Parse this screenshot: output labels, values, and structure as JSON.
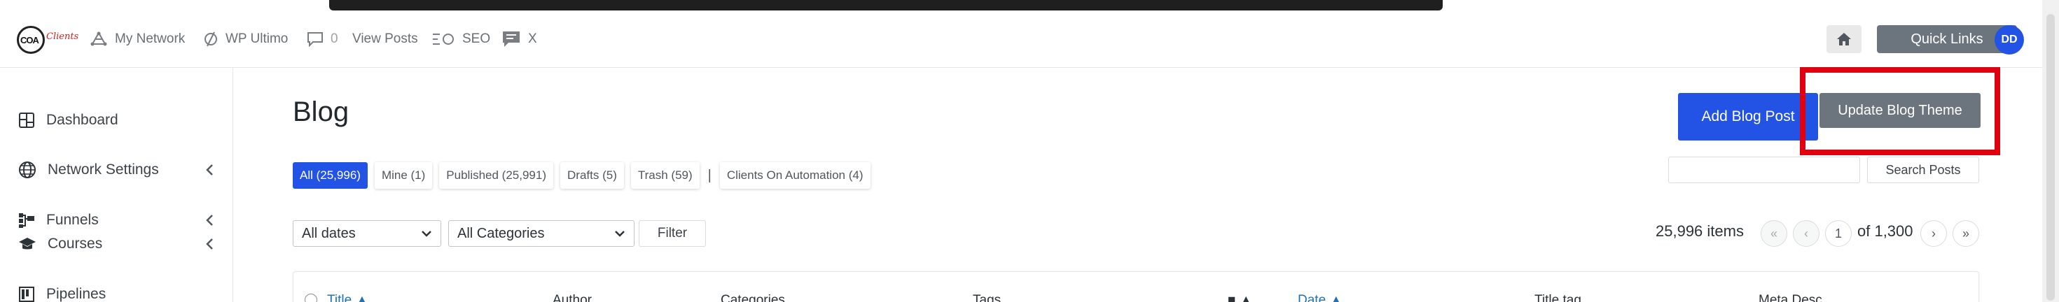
{
  "adminbar": {
    "logo_text": "COA",
    "logo_script": "Clients",
    "items": [
      {
        "label": "My Network",
        "icon": "network-icon"
      },
      {
        "label": "WP Ultimo",
        "icon": "wp-ultimo-icon"
      },
      {
        "label": "0",
        "icon": "comment-icon"
      },
      {
        "label": "View Posts",
        "icon": ""
      },
      {
        "label": "SEO",
        "icon": "seo-icon"
      },
      {
        "label": "X",
        "icon": "chat-icon"
      }
    ],
    "home_icon": "home-icon",
    "quick_links_label": "Quick Links",
    "avatar_initials": "DD"
  },
  "sidebar": {
    "items": [
      {
        "label": "Dashboard",
        "icon": "dashboard-icon",
        "has_chevron": false
      },
      {
        "label": "Network Settings",
        "icon": "globe-icon",
        "has_chevron": true
      },
      {
        "label": "Funnels",
        "icon": "funnel-icon",
        "has_chevron": true
      },
      {
        "label": "Courses",
        "icon": "graduation-cap-icon",
        "has_chevron": true
      },
      {
        "label": "Pipelines",
        "icon": "pipeline-icon",
        "has_chevron": false
      }
    ]
  },
  "main": {
    "title": "Blog",
    "add_button": "Add Blog Post",
    "theme_button": "Update Blog Theme",
    "filter_tabs": [
      {
        "label": "All (25,996)",
        "active": true
      },
      {
        "label": "Mine (1)",
        "active": false
      },
      {
        "label": "Published (25,991)",
        "active": false
      },
      {
        "label": "Drafts (5)",
        "active": false
      },
      {
        "label": "Trash (59)",
        "active": false
      },
      {
        "label": "Clients On Automation (4)",
        "active": false
      }
    ],
    "filter_separator": "|",
    "search": {
      "value": "",
      "button_label": "Search Posts"
    },
    "dates_select": "All dates",
    "categories_select": "All Categories",
    "filter_button": "Filter",
    "items_count": "25,996 items",
    "pagination": {
      "first": "«",
      "prev": "‹",
      "current_page": "1",
      "of_label": "of 1,300",
      "next": "›",
      "last": "»"
    },
    "table_headers": [
      "Title",
      "Author",
      "Categories",
      "Tags",
      "",
      "Date",
      "Title tag",
      "Meta Desc."
    ]
  },
  "colors": {
    "primary": "#2353e4",
    "secondary": "#6c757d",
    "highlight": "#e0000f"
  }
}
